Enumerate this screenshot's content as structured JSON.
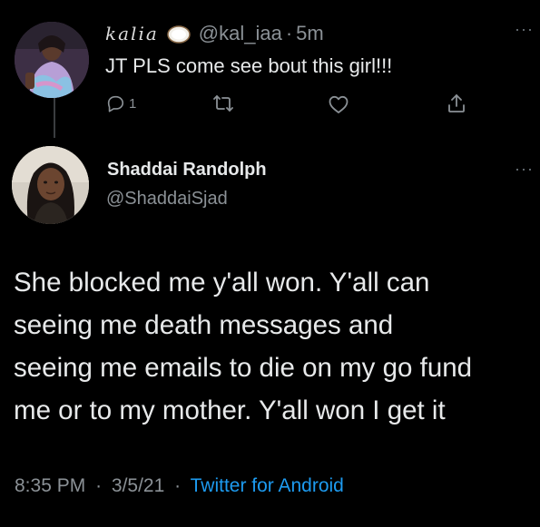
{
  "reply": {
    "display_name": "kalia",
    "handle": "@kal_iaa",
    "separator": "·",
    "time_ago": "5m",
    "text": "JT PLS come see bout this girl!!!",
    "reply_count": "1",
    "more_label": "···"
  },
  "main_tweet": {
    "display_name": "Shaddai Randolph",
    "handle": "@ShaddaiSjad",
    "more_label": "···",
    "text_lines": [
      "She blocked me y'all won. Y'all can",
      "seeing me death messages and",
      "seeing me emails to die on my go fund",
      "me or to my mother. Y'all won I get it"
    ],
    "time": "8:35 PM",
    "separator": "·",
    "date": "3/5/21",
    "source": "Twitter for Android"
  },
  "icons": {
    "reply": "reply-icon",
    "retweet": "retweet-icon",
    "like": "like-icon",
    "share": "share-icon",
    "more": "more-icon",
    "coconut": "coconut-emoji"
  },
  "colors": {
    "background": "#000000",
    "primary_text": "#e7e9ea",
    "secondary_text": "#8b9196",
    "link": "#1d9bf0"
  }
}
